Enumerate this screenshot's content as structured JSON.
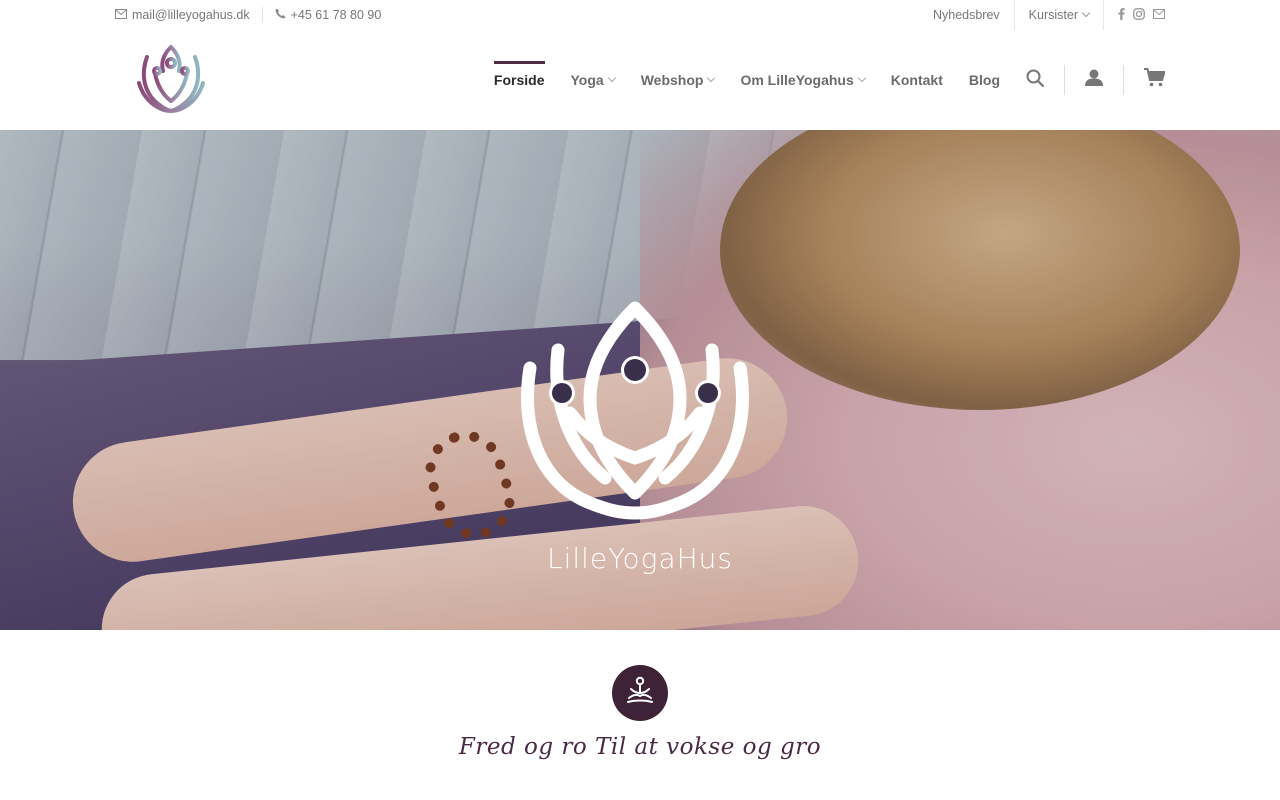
{
  "topbar": {
    "email": "mail@lilleyogahus.dk",
    "phone": "+45 61 78 80 90",
    "links": [
      "Nyhedsbrev",
      "Kursister"
    ],
    "social_icons": [
      "facebook-icon",
      "instagram-icon",
      "envelope-icon"
    ]
  },
  "nav": {
    "items": [
      {
        "label": "Forside",
        "active": true,
        "dropdown": false
      },
      {
        "label": "Yoga",
        "active": false,
        "dropdown": true
      },
      {
        "label": "Webshop",
        "active": false,
        "dropdown": true
      },
      {
        "label": "Om LilleYogahus",
        "active": false,
        "dropdown": true
      },
      {
        "label": "Kontakt",
        "active": false,
        "dropdown": false
      },
      {
        "label": "Blog",
        "active": false,
        "dropdown": false
      }
    ],
    "icons": [
      "search-icon",
      "user-icon",
      "cart-icon"
    ]
  },
  "hero": {
    "title": "LilleYogaHus"
  },
  "intro": {
    "tagline": "Fred og ro Til at vokse og gro"
  },
  "colors": {
    "accent": "#4f2c44",
    "badge": "#3e2238",
    "tagline": "#4a2a45"
  }
}
